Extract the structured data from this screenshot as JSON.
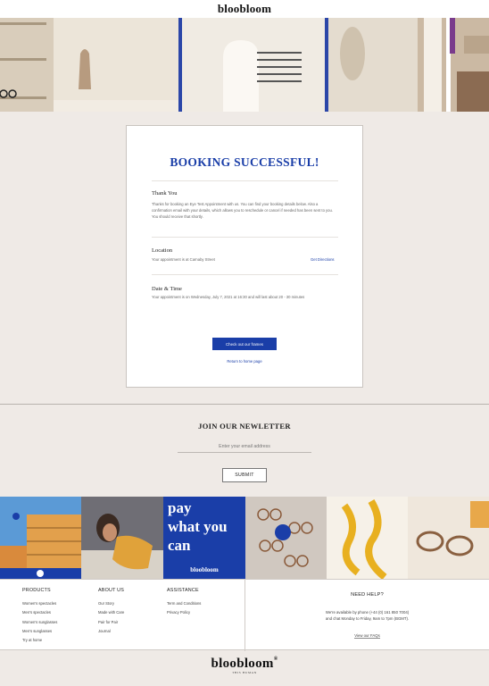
{
  "header": {
    "logo": "bloobloom"
  },
  "booking": {
    "title": "BOOKING SUCCESSFUL!",
    "thank_you": {
      "heading": "Thank You",
      "text": "Thanks for booking an Eye Test Appointment with us. You can find your booking details below. Also a confirmation email with your details, which allows you to reschedule or cancel if needed has been sent to you. You should receive that shortly."
    },
    "location": {
      "heading": "Location",
      "text": "Your appointment is at Carnaby Street",
      "link": "Get Directions"
    },
    "datetime": {
      "heading": "Date & Time",
      "text": "Your appointment is on Wednesday, July 7, 2021 at 16:30 and will last about 20 - 30 minutes"
    },
    "frames_button": "Check out our frames",
    "return_link": "Return to home page"
  },
  "newsletter": {
    "title": "JOIN OUR NEWLETTER",
    "placeholder": "Enter your email address",
    "submit": "SUBMIT"
  },
  "strip": {
    "pay_lines": [
      "pay",
      "what you",
      "can"
    ],
    "pay_logo": "bloobloom"
  },
  "footer": {
    "products": {
      "heading": "PRODUCTS",
      "links": [
        "Women's spectacles",
        "Men's spectacles",
        "Women's sunglasses",
        "Men's sunglasses",
        "Try at home"
      ]
    },
    "about": {
      "heading": "ABOUT US",
      "links": [
        "Our Story",
        "Made with Care",
        "Pair for Pair",
        "Journal"
      ]
    },
    "assistance": {
      "heading": "ASSISTANCE",
      "links": [
        "Term and Conditions",
        "Privacy Policy"
      ]
    },
    "help": {
      "heading": "NEED HELP?",
      "line1": "We're available by phone (+44 (0) 161 850 7004)",
      "line2": "and chat Monday to Friday, 9am to 7pm (BGMT).",
      "faq": "View our FAQs"
    }
  },
  "bottom_logo": {
    "name": "bloobloom",
    "reg": "®",
    "tagline": "THIS HUMAN"
  },
  "colors": {
    "brand_blue": "#1a3ea8",
    "page_bg": "#efeae6"
  }
}
